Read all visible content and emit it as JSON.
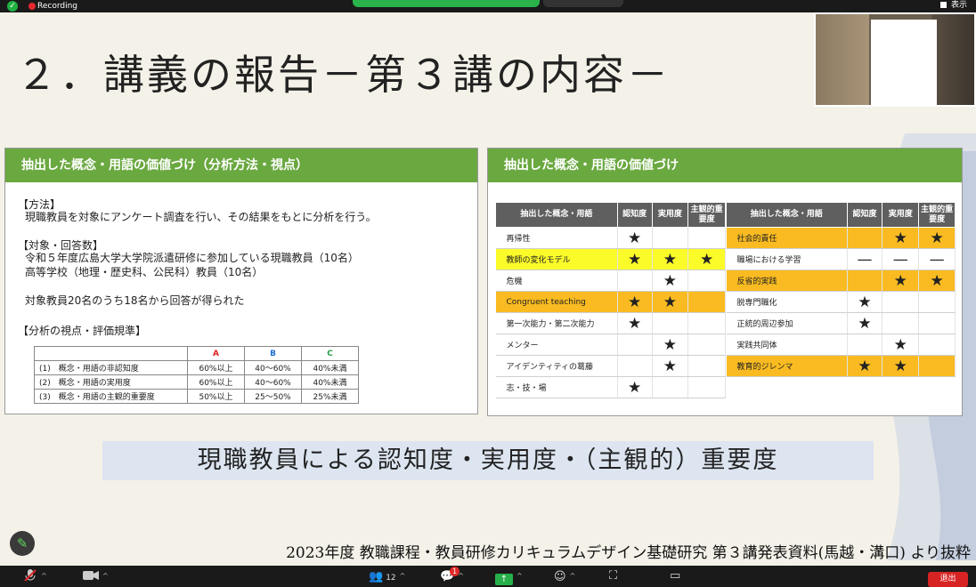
{
  "app": {
    "recording_label": "Recording",
    "view_label": "表示"
  },
  "slide": {
    "title": "２．講義の報告－第３講の内容－",
    "left_panel": {
      "header": "抽出した概念・用語の価値づけ（分析方法・視点）",
      "method_heading": "【方法】",
      "method_text": "現職教員を対象にアンケート調査を行い、その結果をもとに分析を行う。",
      "subjects_heading": "【対象・回答数】",
      "subjects_line1": "令和５年度広島大学大学院派遣研修に参加している現職教員（10名）",
      "subjects_line2": "高等学校（地理・歴史科、公民科）教員（10名）",
      "response_text": "対象教員20名のうち18名から回答が得られた",
      "criteria_heading": "【分析の視点・評価規準】",
      "criteria_table": {
        "headers": [
          "A",
          "B",
          "C"
        ],
        "rows": [
          {
            "label": "(1)　概念・用語の非認知度",
            "a": "60%以上",
            "b": "40～60%",
            "c": "40%未満"
          },
          {
            "label": "(2)　概念・用語の実用度",
            "a": "60%以上",
            "b": "40～60%",
            "c": "40%未満"
          },
          {
            "label": "(3)　概念・用語の主観的重要度",
            "a": "50%以上",
            "b": "25～50%",
            "c": "25%未満"
          }
        ]
      }
    },
    "right_panel": {
      "header": "抽出した概念・用語の価値づけ",
      "col_headers": {
        "term": "抽出した概念・用語",
        "recognition": "認知度",
        "practical": "実用度",
        "importance": "主観的重要度"
      },
      "table1": [
        {
          "term": "再帰性",
          "r": "star",
          "p": "",
          "i": "",
          "hl": ""
        },
        {
          "term": "教師の変化モデル",
          "r": "star",
          "p": "star",
          "i": "star",
          "hl": "yellow"
        },
        {
          "term": "危機",
          "r": "",
          "p": "star",
          "i": "",
          "hl": ""
        },
        {
          "term": "Congruent teaching",
          "r": "star",
          "p": "star",
          "i": "",
          "hl": "orange"
        },
        {
          "term": "第一次能力・第二次能力",
          "r": "star",
          "p": "",
          "i": "",
          "hl": ""
        },
        {
          "term": "メンター",
          "r": "",
          "p": "star",
          "i": "",
          "hl": ""
        },
        {
          "term": "アイデンティティの葛藤",
          "r": "",
          "p": "star",
          "i": "",
          "hl": ""
        },
        {
          "term": "志・技・場",
          "r": "star",
          "p": "",
          "i": "",
          "hl": ""
        }
      ],
      "table2": [
        {
          "term": "社会的責任",
          "r": "",
          "p": "star",
          "i": "star",
          "hl": "orange"
        },
        {
          "term": "職場における学習",
          "r": "dash",
          "p": "dash",
          "i": "dash",
          "hl": ""
        },
        {
          "term": "反省的実践",
          "r": "",
          "p": "star",
          "i": "star",
          "hl": "orange"
        },
        {
          "term": "脱専門職化",
          "r": "star",
          "p": "",
          "i": "",
          "hl": ""
        },
        {
          "term": "正統的周辺参加",
          "r": "star",
          "p": "",
          "i": "",
          "hl": ""
        },
        {
          "term": "実践共同体",
          "r": "",
          "p": "star",
          "i": "",
          "hl": ""
        },
        {
          "term": "教育的ジレンマ",
          "r": "star",
          "p": "star",
          "i": "",
          "hl": "orange"
        }
      ]
    },
    "banner": "現職教員による認知度・実用度・（主観的）重要度",
    "footer": "2023年度 教職課程・教員研修カリキュラムデザイン基礎研究 第３講発表資料(馬越・溝口) より抜粋"
  },
  "toolbar": {
    "participants_count": "12",
    "chat_badge": "1",
    "leave_label": "退出"
  }
}
